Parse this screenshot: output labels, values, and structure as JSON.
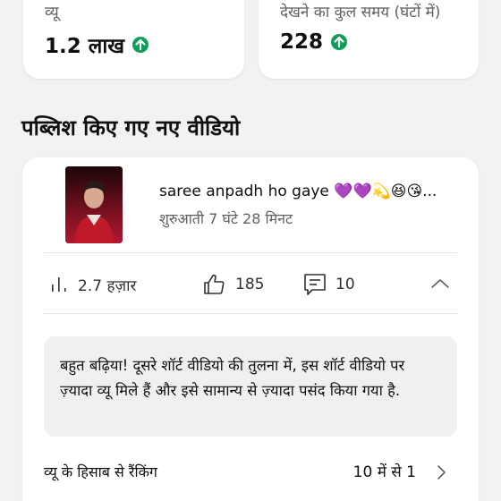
{
  "metrics": [
    {
      "label": "व्यू",
      "value": "1.2 लाख",
      "trend_icon": "arrow-up-circle-icon",
      "trend_color": "#0f9d58"
    },
    {
      "label": "देखने का कुल समय (घंटों में)",
      "value": "228",
      "trend_icon": "arrow-up-circle-icon",
      "trend_color": "#0f9d58"
    }
  ],
  "section": {
    "title": "पब्लिश किए गए नए वीडियो"
  },
  "video": {
    "title": "saree anpadh ho gaye 💜💜💫😆😘...",
    "subtitle": "शुरुआती 7 घंटे 28 मिनट",
    "stats": {
      "views": "2.7 हज़ार",
      "likes": "185",
      "comments": "10"
    },
    "insight": "बहुत बढ़िया! दूसरे शॉर्ट वीडियो की तुलना में, इस शॉर्ट वीडियो पर ज़्यादा व्यू मिले हैं और इसे सामान्य से ज़्यादा पसंद किया गया है.",
    "ranking": {
      "label": "व्यू के हिसाब से रैंकिंग",
      "value": "10 में से 1"
    }
  },
  "colors": {
    "background": "#f2f2f2",
    "card": "#ffffff",
    "insight_bg": "#f0f0f0",
    "up_green": "#0f9d58",
    "thumbnail": "#5a0d18"
  }
}
